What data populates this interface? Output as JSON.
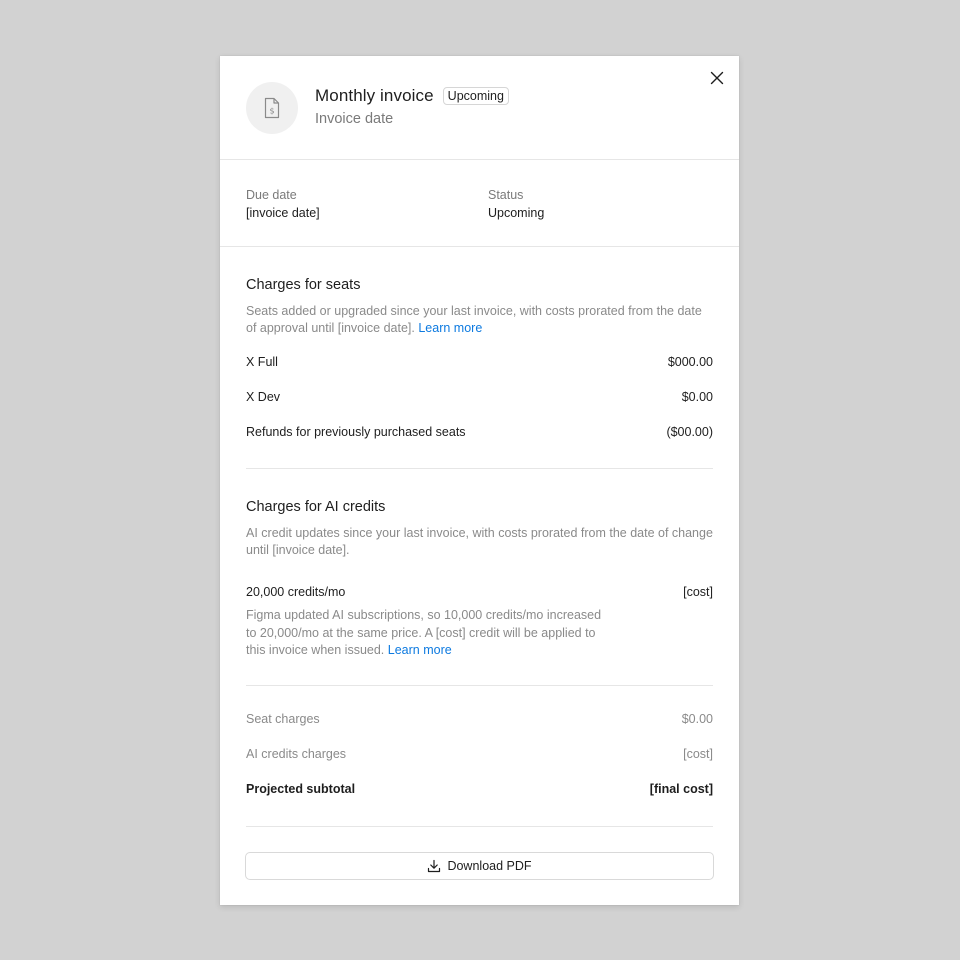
{
  "header": {
    "title": "Monthly invoice",
    "badge": "Upcoming",
    "subtitle": "Invoice date",
    "icon": "invoice-dollar-icon"
  },
  "meta": {
    "due_label": "Due date",
    "due_value": "[invoice date]",
    "status_label": "Status",
    "status_value": "Upcoming"
  },
  "seats": {
    "title": "Charges for seats",
    "description": "Seats added or upgraded since your last invoice, with costs prorated from the date of approval until [invoice date].",
    "link": "Learn more",
    "rows": [
      {
        "label": "X Full",
        "amount": "$000.00"
      },
      {
        "label": "X Dev",
        "amount": "$0.00"
      },
      {
        "label": "Refunds for previously purchased seats",
        "amount": "($00.00)"
      }
    ]
  },
  "ai_credits": {
    "title": "Charges for AI credits",
    "description": "AI credit updates since your last invoice, with costs prorated from the date of change until [invoice date].",
    "plan_label": "20,000 credits/mo",
    "plan_amount": "[cost]",
    "note": "Figma updated AI subscriptions, so 10,000 credits/mo increased to 20,000/mo at the same price. A [cost] credit will be applied to this invoice when issued.",
    "note_link": "Learn more"
  },
  "summary": {
    "seat_label": "Seat charges",
    "seat_amount": "$0.00",
    "ai_label": "AI credits charges",
    "ai_amount": "[cost]",
    "subtotal_label": "Projected subtotal",
    "subtotal_amount": "[final cost]"
  },
  "footer": {
    "download_label": "Download PDF",
    "download_icon": "download-icon"
  },
  "colors": {
    "accent_link": "#0d7ae0",
    "backdrop": "#d2d2d2"
  }
}
